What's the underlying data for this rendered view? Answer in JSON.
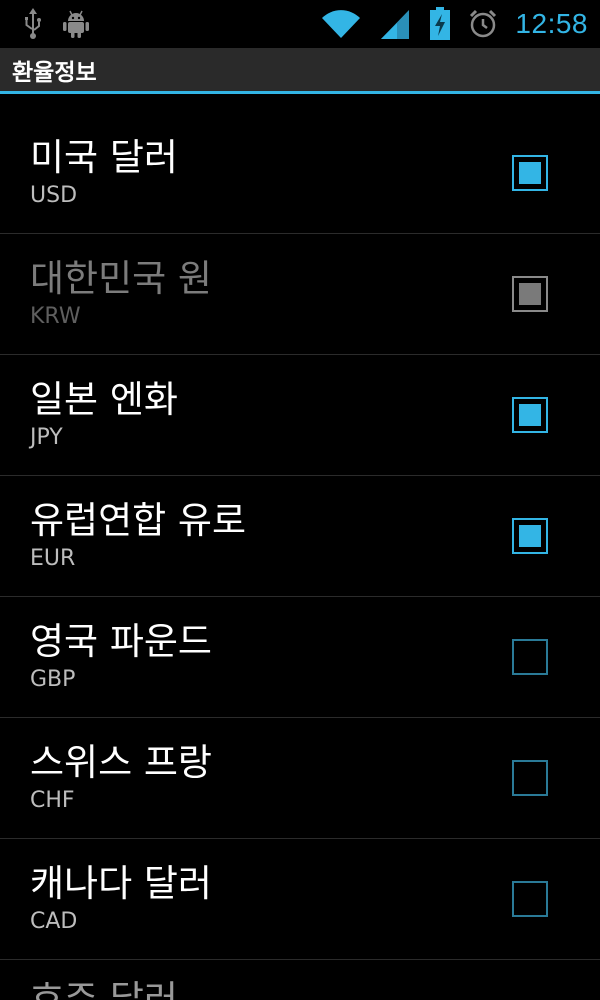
{
  "status_bar": {
    "time": "12:58",
    "icons": [
      "usb-icon",
      "android-debug-icon",
      "wifi-icon",
      "signal-icon",
      "battery-charging-icon",
      "alarm-icon"
    ],
    "accent_color": "#33b5e5"
  },
  "title_bar": {
    "title": "환율정보"
  },
  "currencies": [
    {
      "name": "미국 달러",
      "code": "USD",
      "checked": true,
      "enabled": true
    },
    {
      "name": "대한민국 원",
      "code": "KRW",
      "checked": true,
      "enabled": false
    },
    {
      "name": "일본 엔화",
      "code": "JPY",
      "checked": true,
      "enabled": true
    },
    {
      "name": "유럽연합 유로",
      "code": "EUR",
      "checked": true,
      "enabled": true
    },
    {
      "name": "영국 파운드",
      "code": "GBP",
      "checked": false,
      "enabled": true
    },
    {
      "name": "스위스 프랑",
      "code": "CHF",
      "checked": false,
      "enabled": true
    },
    {
      "name": "캐나다 달러",
      "code": "CAD",
      "checked": false,
      "enabled": true
    }
  ],
  "partial_next_item": {
    "name": "호주 달러"
  }
}
